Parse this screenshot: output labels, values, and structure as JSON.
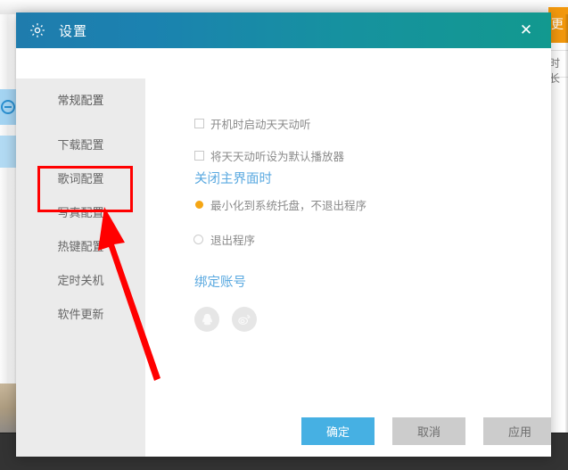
{
  "background": {
    "orange_button_label": "更",
    "right_column_text": "时长",
    "left_rail_icon": "circle-minus-icon"
  },
  "dialog": {
    "titlebar": {
      "icon": "gear-icon",
      "title": "设置",
      "close_label": "✕",
      "gradient_from": "#1f7cad",
      "gradient_to": "#12998f"
    },
    "sidebar": {
      "items": [
        {
          "label": "常规配置",
          "active": true
        },
        {
          "label": "下载配置",
          "active": false
        },
        {
          "label": "歌词配置",
          "active": false
        },
        {
          "label": "写真配置",
          "active": false
        },
        {
          "label": "热键配置",
          "active": false
        },
        {
          "label": "定时关机",
          "active": false
        },
        {
          "label": "软件更新",
          "active": false
        }
      ]
    },
    "content": {
      "checkboxes": [
        {
          "label": "开机时启动天天动听",
          "checked": false
        },
        {
          "label": "将天天动听设为默认播放器",
          "checked": false
        }
      ],
      "close_section": {
        "title": "关闭主界面时",
        "options": [
          {
            "label": "最小化到系统托盘，不退出程序",
            "selected": true
          },
          {
            "label": "退出程序",
            "selected": false
          }
        ],
        "selected_color": "#f5a614"
      },
      "bind_section": {
        "title": "绑定账号",
        "accounts": [
          {
            "name": "qq-icon"
          },
          {
            "name": "weibo-icon"
          }
        ]
      }
    },
    "footer": {
      "ok_label": "确定",
      "cancel_label": "取消",
      "apply_label": "应用",
      "primary_color": "#46b0e3"
    }
  },
  "annotations": {
    "highlight_color": "#ff0000",
    "highlight_target": "热键配置",
    "arrow_color": "#ff0000"
  }
}
